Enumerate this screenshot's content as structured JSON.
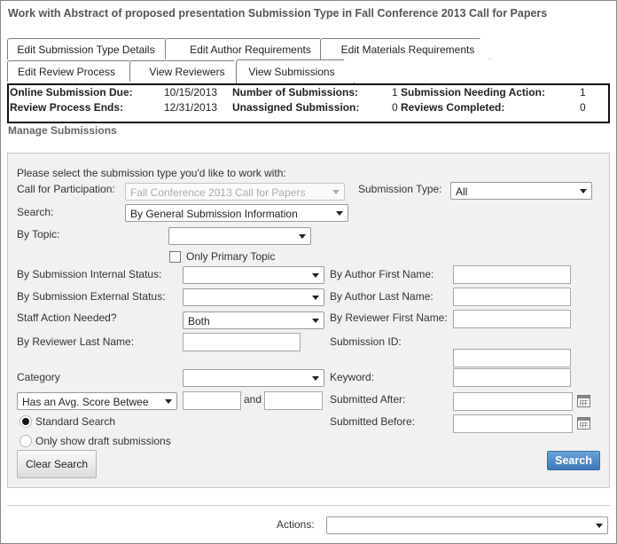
{
  "page": {
    "title": "Work with Abstract of proposed presentation Submission Type in Fall Conference 2013 Call for Papers"
  },
  "tabs_row1": [
    {
      "label": "Edit Submission Type Details"
    },
    {
      "label": "Edit Author Requirements"
    },
    {
      "label": "Edit Materials Requirements"
    }
  ],
  "tabs_row2": [
    {
      "label": "Edit Review Process"
    },
    {
      "label": "View Reviewers"
    },
    {
      "label": "View Submissions",
      "active": true
    }
  ],
  "summary": {
    "online_due_label": "Online Submission Due:",
    "online_due_value": "10/15/2013",
    "review_ends_label": "Review Process Ends:",
    "review_ends_value": "12/31/2013",
    "num_submissions_label": "Number of Submissions:",
    "num_submissions_value": "1",
    "unassigned_label": "Unassigned Submission:",
    "unassigned_value": "0",
    "needing_action_label": "Submission Needing Action:",
    "needing_action_value": "1",
    "reviews_completed_label": "Reviews Completed:",
    "reviews_completed_value": "0"
  },
  "manage": {
    "title": "Manage Submissions"
  },
  "form": {
    "instruction": "Please select the submission type you'd like to work with:",
    "call_label": "Call for Participation:",
    "call_value": "Fall Conference 2013 Call for Papers",
    "type_label": "Submission Type:",
    "type_value": "All",
    "search_label": "Search:",
    "search_value": "By General Submission Information",
    "topic_label": "By Topic:",
    "topic_value": "",
    "primary_topic_label": "Only Primary Topic",
    "internal_status_label": "By Submission Internal Status:",
    "internal_status_value": "",
    "external_status_label": "By Submission External Status:",
    "external_status_value": "",
    "staff_action_label": "Staff Action Needed?",
    "staff_action_value": "Both",
    "reviewer_last_label": "By Reviewer Last Name:",
    "author_first_label": "By Author First Name:",
    "author_last_label": "By Author Last Name:",
    "reviewer_first_label": "By Reviewer First Name:",
    "submission_id_label": "Submission ID:",
    "category_label": "Category",
    "category_value": "",
    "keyword_label": "Keyword:",
    "score_select_value": "Has an Avg. Score Betwee",
    "and_label": "and",
    "submitted_after_label": "Submitted After:",
    "submitted_before_label": "Submitted Before:",
    "standard_search_label": "Standard Search",
    "draft_label": "Only show draft submissions",
    "clear_button": "Clear Search",
    "search_button": "Search"
  },
  "footer": {
    "actions_label": "Actions:",
    "actions_value": ""
  }
}
